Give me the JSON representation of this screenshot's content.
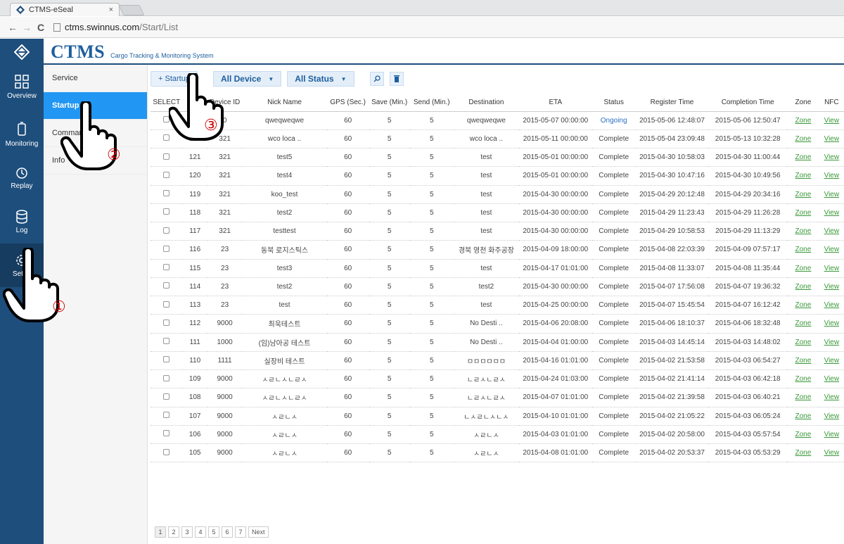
{
  "browser": {
    "tab_title": "CTMS-eSeal",
    "tab_close": "×",
    "url_host": "ctms.swinnus.com",
    "url_path": "/Start/List"
  },
  "brand": {
    "name": "CTMS",
    "subtitle": "Cargo Tracking & Monitoring System",
    "accent": "#1e4e7c"
  },
  "sidebar": {
    "items": [
      {
        "label": "Overview"
      },
      {
        "label": "Monitoring"
      },
      {
        "label": "Replay"
      },
      {
        "label": "Log"
      },
      {
        "label": "Setup"
      }
    ]
  },
  "subnav": {
    "items": [
      {
        "label": "Service"
      },
      {
        "label": "Startup"
      },
      {
        "label": "Command"
      },
      {
        "label": "Info"
      }
    ]
  },
  "toolbar": {
    "startup_label": "+ Startup",
    "device_filter": "All Device",
    "status_filter": "All Status"
  },
  "table": {
    "headers": [
      "SELECT",
      "No.",
      "Device ID",
      "Nick Name",
      "GPS (Sec.)",
      "Save (Min.)",
      "Send (Min.)",
      "Destination",
      "ETA",
      "Status",
      "Register Time",
      "Completion Time",
      "Zone",
      "NFC"
    ],
    "rows": [
      {
        "no": "123",
        "device": "0",
        "nick": "qweqweqwe",
        "gps": "60",
        "save": "5",
        "send": "5",
        "dest": "qweqweqwe",
        "eta": "2015-05-07 00:00:00",
        "status": "Ongoing",
        "reg": "2015-05-06 12:48:07",
        "comp": "2015-05-06 12:50:47",
        "zone": "Zone",
        "nfc": "View"
      },
      {
        "no": "122",
        "device": "321",
        "nick": "wco loca ..",
        "gps": "60",
        "save": "5",
        "send": "5",
        "dest": "wco loca ..",
        "eta": "2015-05-11 00:00:00",
        "status": "Complete",
        "reg": "2015-05-04 23:09:48",
        "comp": "2015-05-13 10:32:28",
        "zone": "Zone",
        "nfc": "View"
      },
      {
        "no": "121",
        "device": "321",
        "nick": "test5",
        "gps": "60",
        "save": "5",
        "send": "5",
        "dest": "test",
        "eta": "2015-05-01 00:00:00",
        "status": "Complete",
        "reg": "2015-04-30 10:58:03",
        "comp": "2015-04-30 11:00:44",
        "zone": "Zone",
        "nfc": "View"
      },
      {
        "no": "120",
        "device": "321",
        "nick": "test4",
        "gps": "60",
        "save": "5",
        "send": "5",
        "dest": "test",
        "eta": "2015-05-01 00:00:00",
        "status": "Complete",
        "reg": "2015-04-30 10:47:16",
        "comp": "2015-04-30 10:49:56",
        "zone": "Zone",
        "nfc": "View"
      },
      {
        "no": "119",
        "device": "321",
        "nick": "koo_test",
        "gps": "60",
        "save": "5",
        "send": "5",
        "dest": "test",
        "eta": "2015-04-30 00:00:00",
        "status": "Complete",
        "reg": "2015-04-29 20:12:48",
        "comp": "2015-04-29 20:34:16",
        "zone": "Zone",
        "nfc": "View"
      },
      {
        "no": "118",
        "device": "321",
        "nick": "test2",
        "gps": "60",
        "save": "5",
        "send": "5",
        "dest": "test",
        "eta": "2015-04-30 00:00:00",
        "status": "Complete",
        "reg": "2015-04-29 11:23:43",
        "comp": "2015-04-29 11:26:28",
        "zone": "Zone",
        "nfc": "View"
      },
      {
        "no": "117",
        "device": "321",
        "nick": "testtest",
        "gps": "60",
        "save": "5",
        "send": "5",
        "dest": "test",
        "eta": "2015-04-30 00:00:00",
        "status": "Complete",
        "reg": "2015-04-29 10:58:53",
        "comp": "2015-04-29 11:13:29",
        "zone": "Zone",
        "nfc": "View"
      },
      {
        "no": "116",
        "device": "23",
        "nick": "동북 로지스틱스",
        "gps": "60",
        "save": "5",
        "send": "5",
        "dest": "경북 영천 화주공장",
        "eta": "2015-04-09 18:00:00",
        "status": "Complete",
        "reg": "2015-04-08 22:03:39",
        "comp": "2015-04-09 07:57:17",
        "zone": "Zone",
        "nfc": "View"
      },
      {
        "no": "115",
        "device": "23",
        "nick": "test3",
        "gps": "60",
        "save": "5",
        "send": "5",
        "dest": "test",
        "eta": "2015-04-17 01:01:00",
        "status": "Complete",
        "reg": "2015-04-08 11:33:07",
        "comp": "2015-04-08 11:35:44",
        "zone": "Zone",
        "nfc": "View"
      },
      {
        "no": "114",
        "device": "23",
        "nick": "test2",
        "gps": "60",
        "save": "5",
        "send": "5",
        "dest": "test2",
        "eta": "2015-04-30 00:00:00",
        "status": "Complete",
        "reg": "2015-04-07 17:56:08",
        "comp": "2015-04-07 19:36:32",
        "zone": "Zone",
        "nfc": "View"
      },
      {
        "no": "113",
        "device": "23",
        "nick": "test",
        "gps": "60",
        "save": "5",
        "send": "5",
        "dest": "test",
        "eta": "2015-04-25 00:00:00",
        "status": "Complete",
        "reg": "2015-04-07 15:45:54",
        "comp": "2015-04-07 16:12:42",
        "zone": "Zone",
        "nfc": "View"
      },
      {
        "no": "112",
        "device": "9000",
        "nick": "최욱테스트",
        "gps": "60",
        "save": "5",
        "send": "5",
        "dest": "No Desti ..",
        "eta": "2015-04-06 20:08:00",
        "status": "Complete",
        "reg": "2015-04-06 18:10:37",
        "comp": "2015-04-06 18:32:48",
        "zone": "Zone",
        "nfc": "View"
      },
      {
        "no": "111",
        "device": "1000",
        "nick": "(임)남아공 테스트",
        "gps": "60",
        "save": "5",
        "send": "5",
        "dest": "No Desti ..",
        "eta": "2015-04-04 01:00:00",
        "status": "Complete",
        "reg": "2015-04-03 14:45:14",
        "comp": "2015-04-03 14:48:02",
        "zone": "Zone",
        "nfc": "View"
      },
      {
        "no": "110",
        "device": "1111",
        "nick": "실장비 테스트",
        "gps": "60",
        "save": "5",
        "send": "5",
        "dest": "ㅁㅁㅁㅁㅁㅁ",
        "eta": "2015-04-16 01:01:00",
        "status": "Complete",
        "reg": "2015-04-02 21:53:58",
        "comp": "2015-04-03 06:54:27",
        "zone": "Zone",
        "nfc": "View"
      },
      {
        "no": "109",
        "device": "9000",
        "nick": "ㅅㄹㄴㅅㄴㄹㅅ",
        "gps": "60",
        "save": "5",
        "send": "5",
        "dest": "ㄴㄹㅅㄴㄹㅅ",
        "eta": "2015-04-24 01:03:00",
        "status": "Complete",
        "reg": "2015-04-02 21:41:14",
        "comp": "2015-04-03 06:42:18",
        "zone": "Zone",
        "nfc": "View"
      },
      {
        "no": "108",
        "device": "9000",
        "nick": "ㅅㄹㄴㅅㄴㄹㅅ",
        "gps": "60",
        "save": "5",
        "send": "5",
        "dest": "ㄴㄹㅅㄴㄹㅅ",
        "eta": "2015-04-07 01:01:00",
        "status": "Complete",
        "reg": "2015-04-02 21:39:58",
        "comp": "2015-04-03 06:40:21",
        "zone": "Zone",
        "nfc": "View"
      },
      {
        "no": "107",
        "device": "9000",
        "nick": "ㅅㄹㄴㅅ",
        "gps": "60",
        "save": "5",
        "send": "5",
        "dest": "ㄴㅅㄹㄴㅅㄴㅅ",
        "eta": "2015-04-10 01:01:00",
        "status": "Complete",
        "reg": "2015-04-02 21:05:22",
        "comp": "2015-04-03 06:05:24",
        "zone": "Zone",
        "nfc": "View"
      },
      {
        "no": "106",
        "device": "9000",
        "nick": "ㅅㄹㄴㅅ",
        "gps": "60",
        "save": "5",
        "send": "5",
        "dest": "ㅅㄹㄴㅅ",
        "eta": "2015-04-03 01:01:00",
        "status": "Complete",
        "reg": "2015-04-02 20:58:00",
        "comp": "2015-04-03 05:57:54",
        "zone": "Zone",
        "nfc": "View"
      },
      {
        "no": "105",
        "device": "9000",
        "nick": "ㅅㄹㄴㅅ",
        "gps": "60",
        "save": "5",
        "send": "5",
        "dest": "ㅅㄹㄴㅅ",
        "eta": "2015-04-08 01:01:00",
        "status": "Complete",
        "reg": "2015-04-02 20:53:37",
        "comp": "2015-04-03 05:53:29",
        "zone": "Zone",
        "nfc": "View"
      }
    ]
  },
  "pagination": {
    "pages": [
      "1",
      "2",
      "3",
      "4",
      "5",
      "6",
      "7"
    ],
    "next_label": "Next"
  },
  "callouts": {
    "one": "①",
    "two": "②",
    "three": "③"
  }
}
